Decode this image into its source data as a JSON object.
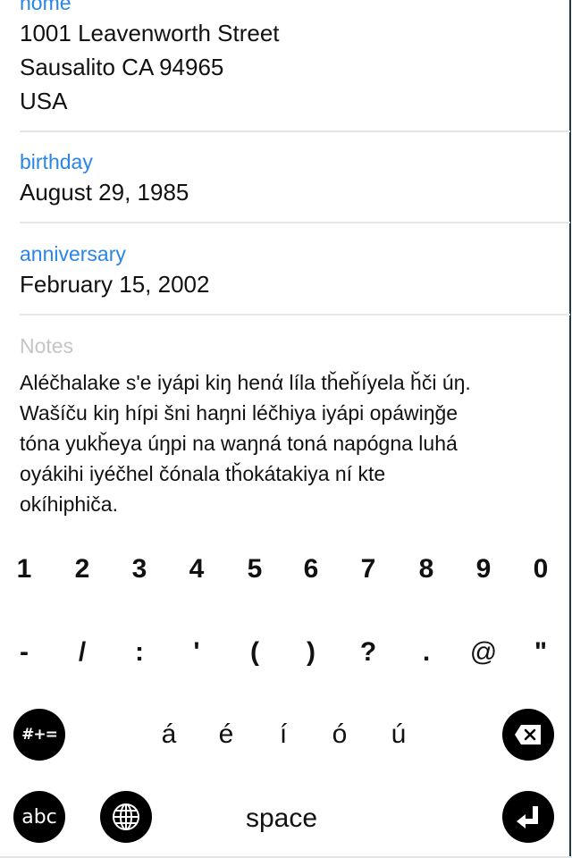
{
  "contact": {
    "address": {
      "label": "home",
      "lines": [
        "1001  Leavenworth Street",
        "Sausalito CA 94965",
        "USA"
      ]
    },
    "birthday": {
      "label": "birthday",
      "value": "August 29, 1985"
    },
    "anniversary": {
      "label": "anniversary",
      "value": "February 15, 2002"
    },
    "notes": {
      "placeholder": "Notes",
      "lines": [
        "Aléčhalake s'e iyápi kiŋ henά líla tȟeȟíyela ȟči úŋ.",
        "Wašíču kiŋ hípi šni haŋni léčhiya iyápi opáwiŋǧe",
        "tóna yukȟeya úŋpi na waŋná toná napógna luhá",
        "oyákihi iyéčhel čónala tȟokátakiya ní kte",
        "okíhiphiča."
      ]
    }
  },
  "keyboard": {
    "row1": [
      "1",
      "2",
      "3",
      "4",
      "5",
      "6",
      "7",
      "8",
      "9",
      "0"
    ],
    "row2": [
      "-",
      "/",
      ":",
      "'",
      "(",
      ")",
      "?",
      ".",
      "@",
      "\""
    ],
    "row3": {
      "symbols_toggle": "#+=",
      "accents": [
        "á",
        "é",
        "í",
        "ó",
        "ú"
      ],
      "delete_icon": "backspace-icon"
    },
    "row4": {
      "abc_toggle": "abc",
      "globe_icon": "globe-icon",
      "space": "space",
      "return_icon": "return-icon"
    }
  },
  "colors": {
    "label_blue": "#2a85e8",
    "placeholder_gray": "#c5c5c5",
    "key_circle": "#000000"
  }
}
